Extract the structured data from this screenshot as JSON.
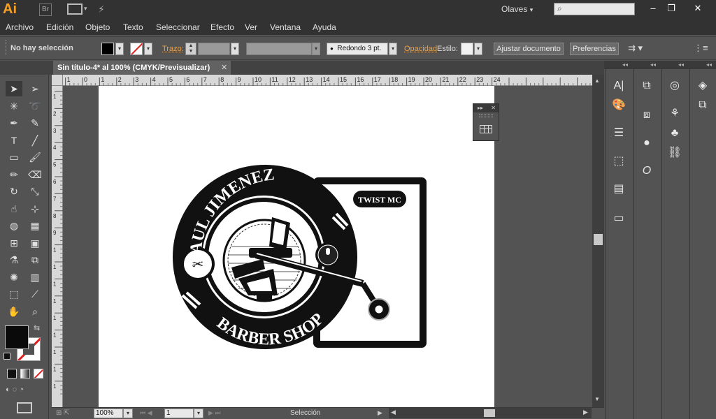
{
  "app": {
    "logo": "Ai",
    "bridge": "Br",
    "workspace": "Olaves",
    "search_placeholder": ""
  },
  "window_controls": {
    "minimize": "–",
    "restore": "❐",
    "close": "✕"
  },
  "menu": [
    "Archivo",
    "Edición",
    "Objeto",
    "Texto",
    "Seleccionar",
    "Efecto",
    "Ver",
    "Ventana",
    "Ayuda"
  ],
  "control_bar": {
    "selection_status": "No hay selección",
    "stroke_label": "Trazo:",
    "brush_label": "Redondo 3 pt.",
    "opacity_label": "Opacidad",
    "style_label": "Estilo:",
    "adjust_document": "Ajustar documento",
    "preferences": "Preferencias",
    "fill_color": "#000000"
  },
  "document": {
    "tab_title": "Sin título-4* al 100% (CMYK/Previsualizar)",
    "ruler_ticks": [
      "1",
      "0",
      "1",
      "2",
      "3",
      "4",
      "5",
      "6",
      "7",
      "8",
      "9",
      "10",
      "11",
      "12",
      "13",
      "14",
      "15",
      "16",
      "17",
      "18",
      "19",
      "20",
      "21",
      "22",
      "23",
      "24"
    ],
    "vruler_ticks": [
      "1",
      "2",
      "3",
      "4",
      "5",
      "6",
      "7",
      "8",
      "9",
      "1",
      "1",
      "1",
      "1",
      "1",
      "1",
      "1",
      "1",
      "1"
    ]
  },
  "artwork": {
    "arc_top": "PAUL JIMENEZ",
    "arc_bottom": "BARBER SHOP",
    "badge": "TWIST MC"
  },
  "status": {
    "zoom": "100%",
    "page": "1",
    "tool": "Selección"
  },
  "icons": {
    "tools": [
      "selection-tool-icon",
      "direct-selection-tool-icon",
      "magic-wand-icon",
      "lasso-icon",
      "pen-tool-icon",
      "curvature-icon",
      "type-tool-icon",
      "line-tool-icon",
      "rectangle-tool-icon",
      "paintbrush-icon",
      "pencil-icon",
      "eraser-icon",
      "rotate-icon",
      "scale-icon",
      "warp-icon",
      "free-transform-icon",
      "shape-builder-icon",
      "perspective-icon",
      "mesh-icon",
      "gradient-icon",
      "eyedropper-icon",
      "blend-icon",
      "symbol-sprayer-icon",
      "column-graph-icon",
      "artboard-tool-icon",
      "slice-icon",
      "hand-tool-icon",
      "zoom-tool-icon"
    ]
  }
}
